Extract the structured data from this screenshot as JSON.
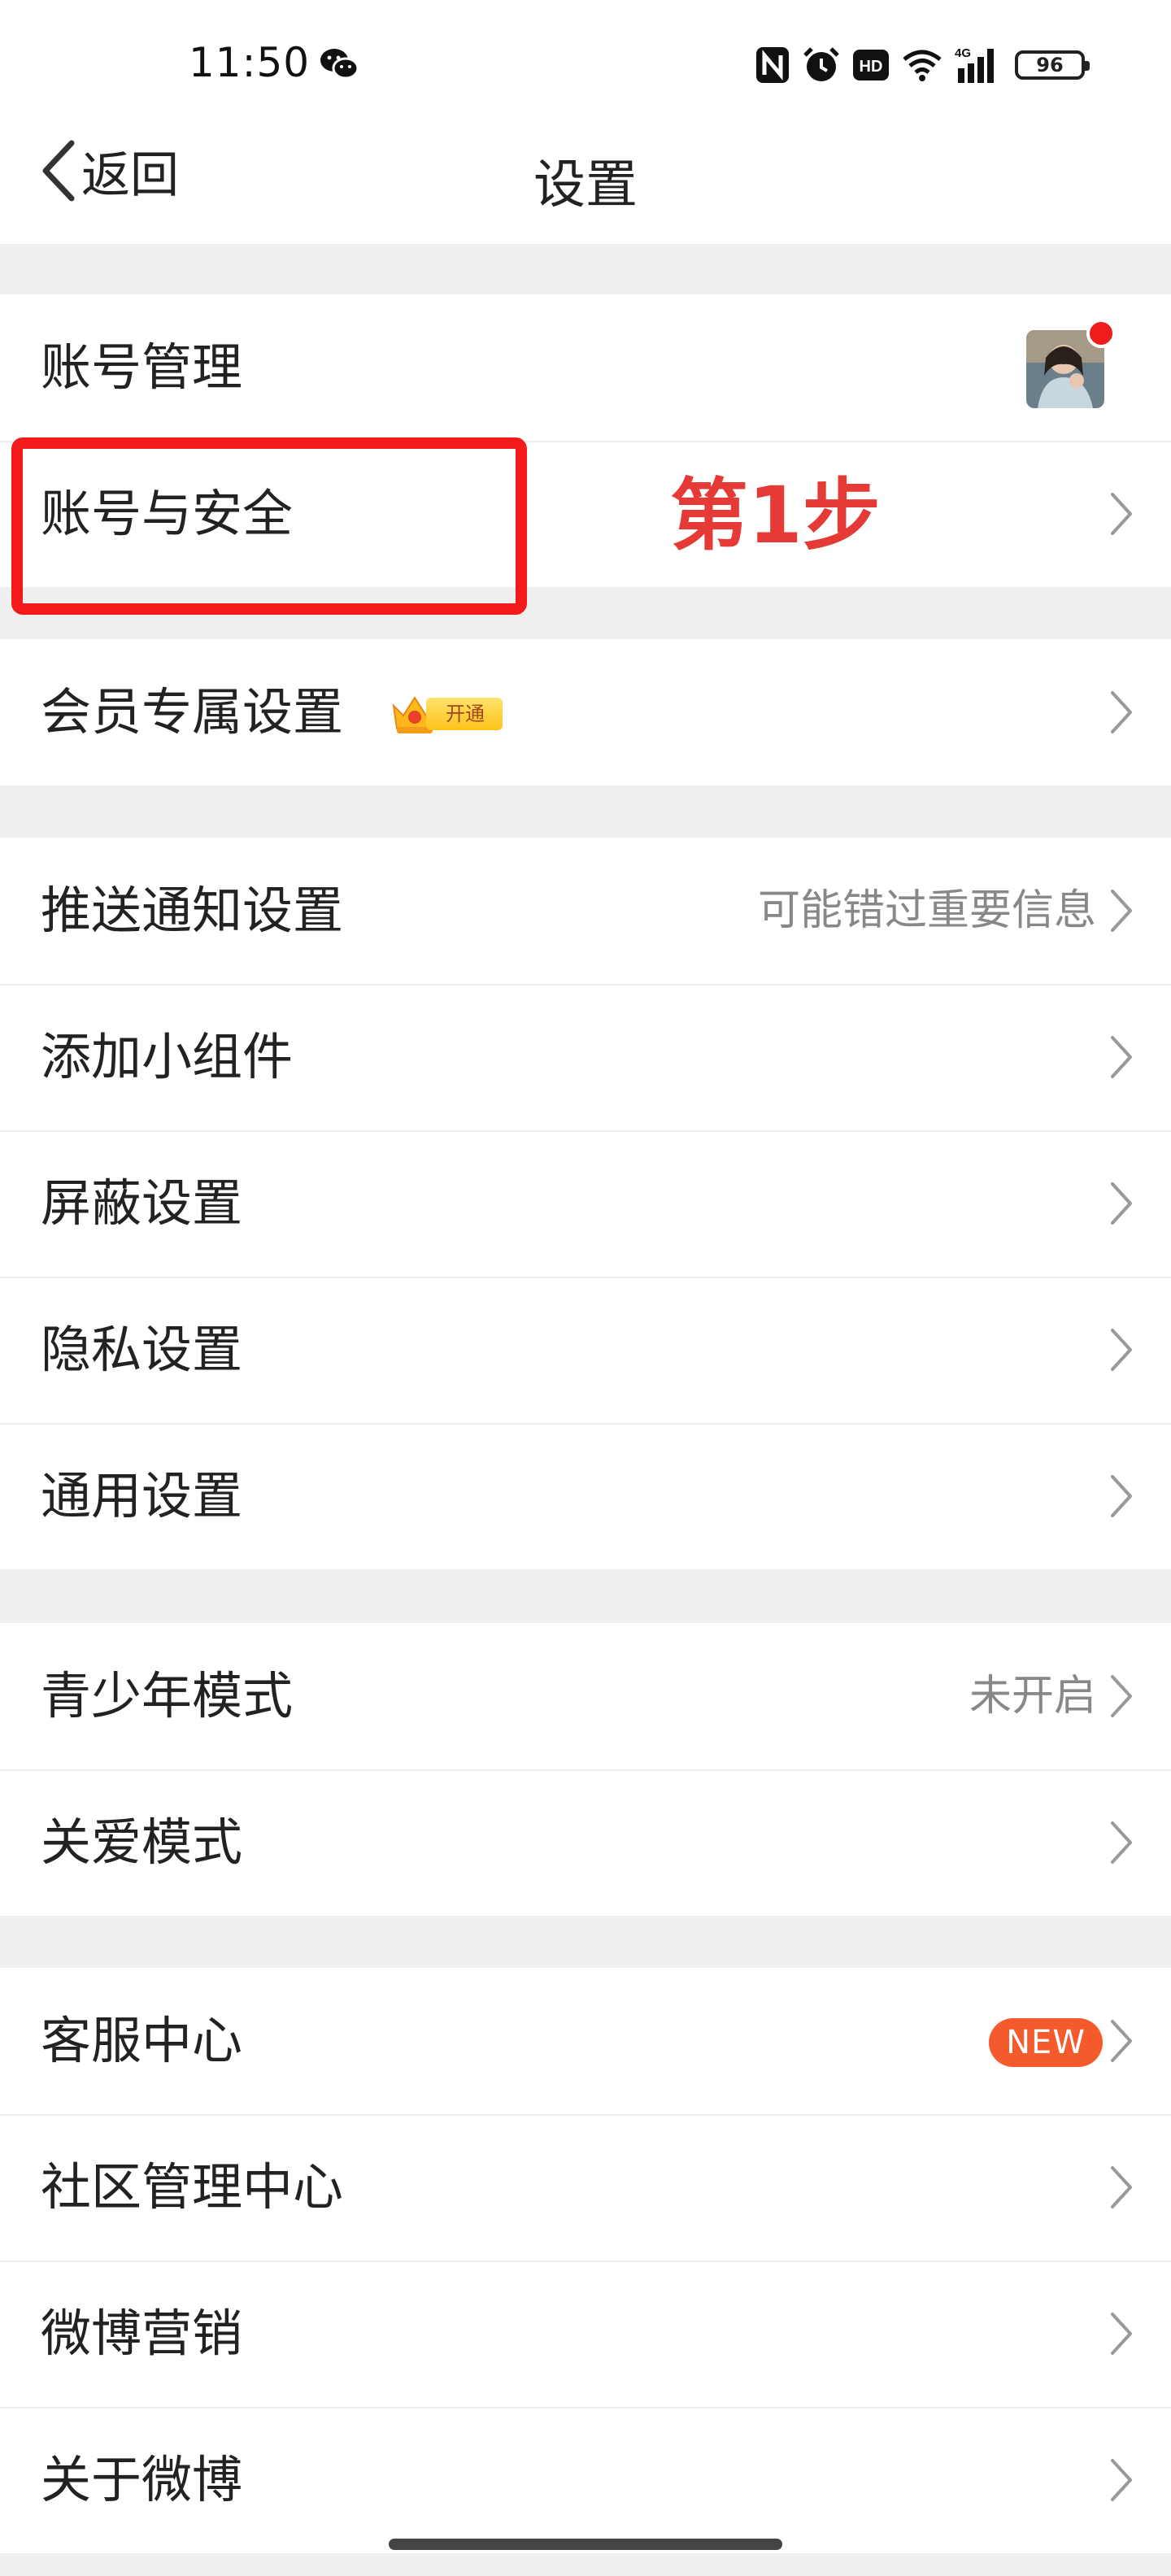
{
  "status_bar": {
    "time": "11:50",
    "network": "4G",
    "battery": "96",
    "icons": [
      "wechat-icon",
      "nfc-icon",
      "alarm-icon",
      "hd-icon",
      "wifi-icon",
      "signal-icon",
      "battery-icon"
    ]
  },
  "nav": {
    "back_label": "返回",
    "title": "设置"
  },
  "groups": [
    {
      "rows": [
        {
          "label": "账号管理",
          "avatar": true,
          "notification_dot": true
        },
        {
          "label": "账号与安全",
          "chevron": true
        }
      ]
    },
    {
      "rows": [
        {
          "label": "会员专属设置",
          "vip_badge": "开通",
          "chevron": true
        }
      ]
    },
    {
      "rows": [
        {
          "label": "推送通知设置",
          "value": "可能错过重要信息",
          "chevron": true
        },
        {
          "label": "添加小组件",
          "chevron": true
        },
        {
          "label": "屏蔽设置",
          "chevron": true
        },
        {
          "label": "隐私设置",
          "chevron": true
        },
        {
          "label": "通用设置",
          "chevron": true
        }
      ]
    },
    {
      "rows": [
        {
          "label": "青少年模式",
          "value": "未开启",
          "chevron": true
        },
        {
          "label": "关爱模式",
          "chevron": true
        }
      ]
    },
    {
      "rows": [
        {
          "label": "客服中心",
          "badge": "NEW",
          "chevron": true
        },
        {
          "label": "社区管理中心",
          "chevron": true
        },
        {
          "label": "微博营销",
          "chevron": true
        },
        {
          "label": "关于微博",
          "chevron": true
        }
      ]
    }
  ],
  "annotation": {
    "text": "第1步"
  },
  "colors": {
    "accent_red": "#f21a1a",
    "annotation_text": "#e53a35",
    "new_badge": "#f45a2c",
    "background": "#efefef"
  }
}
